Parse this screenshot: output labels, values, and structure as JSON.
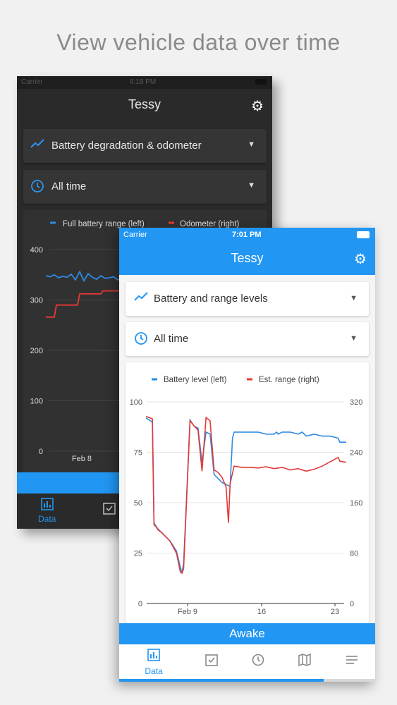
{
  "headline": "View vehicle data over time",
  "back_phone": {
    "status": {
      "carrier": "Carrier",
      "time": "6:18 PM"
    },
    "title": "Tessy",
    "metric_select": "Battery degradation & odometer",
    "range_select": "All time",
    "legend_left": "Full battery range (left)",
    "legend_right": "Odometer (right)",
    "tab_data": "Data"
  },
  "front_phone": {
    "status": {
      "carrier": "Carrier",
      "time": "7:01 PM"
    },
    "title": "Tessy",
    "metric_select": "Battery and range levels",
    "range_select": "All time",
    "awake_label": "Awake",
    "tabs": [
      {
        "name": "data",
        "label": "Data",
        "active": true
      },
      {
        "name": "tasks"
      },
      {
        "name": "history"
      },
      {
        "name": "map"
      },
      {
        "name": "menu"
      }
    ],
    "progress_fraction": 0.8
  },
  "colors": {
    "accent": "#2196f3",
    "series_left": "#2d8ae3",
    "series_right": "#e53935"
  },
  "chart_data": [
    {
      "type": "line",
      "x_ticks": [
        "Feb 8"
      ],
      "y_ticks": [
        0,
        100,
        200,
        300,
        400
      ],
      "ylim": [
        0,
        400
      ],
      "legend": "top",
      "series": [
        {
          "name": "Full battery range (left)",
          "x": [
            0,
            0.1,
            0.2,
            0.3,
            0.4,
            0.5,
            0.6,
            0.7,
            0.8,
            0.9,
            1.0,
            1.1,
            1.2,
            1.3,
            1.4,
            1.5,
            1.6,
            1.7,
            1.8,
            1.9,
            2.0,
            2.1,
            2.2,
            2.3,
            2.4,
            2.5,
            2.6,
            2.7,
            2.8,
            2.9,
            3.0
          ],
          "values": [
            348,
            346,
            350,
            344,
            347,
            345,
            351,
            340,
            356,
            338,
            352,
            345,
            341,
            348,
            343,
            344,
            346,
            340,
            342,
            345,
            341,
            343,
            340,
            342,
            341,
            340,
            342,
            341,
            340,
            341,
            340
          ]
        },
        {
          "name": "Odometer (right)",
          "x": [
            0,
            0.1,
            0.2,
            0.25,
            0.5,
            0.75,
            0.8,
            1.0,
            1.3,
            1.35,
            1.8,
            1.85,
            2.1,
            2.2,
            2.5,
            2.6,
            3.0
          ],
          "values": [
            266,
            266,
            266,
            290,
            290,
            290,
            312,
            312,
            312,
            318,
            318,
            330,
            330,
            336,
            336,
            340,
            340
          ]
        }
      ]
    },
    {
      "type": "line",
      "x_ticks": [
        "Feb 9",
        "16",
        "23"
      ],
      "y_left_ticks": [
        0,
        25,
        50,
        75,
        100
      ],
      "y_right_ticks": [
        0,
        80,
        160,
        240,
        320
      ],
      "ylim_left": [
        0,
        100
      ],
      "ylim_right": [
        0,
        320
      ],
      "legend": "top",
      "series": [
        {
          "name": "Battery level (left)",
          "axis": "left",
          "x": [
            0,
            0.8,
            1.0,
            1.3,
            1.5,
            2.0,
            3.0,
            3.8,
            4.3,
            4.5,
            4.7,
            5.5,
            6.0,
            6.5,
            7.0,
            7.5,
            8.0,
            8.5,
            9.0,
            9.5,
            10.5,
            10.8,
            11.0,
            11.3,
            11.5,
            12.0,
            13,
            14,
            15,
            16,
            16.3,
            16.5,
            17,
            18,
            19,
            19.5,
            20,
            21,
            22,
            23,
            24,
            24.2,
            25
          ],
          "values": [
            92,
            90,
            40,
            38,
            37,
            35,
            31,
            26,
            18,
            15,
            20,
            91,
            88,
            87,
            70,
            85,
            84,
            64,
            62,
            60,
            58,
            82,
            85,
            85,
            85,
            85,
            85,
            85,
            84,
            84,
            85,
            84,
            85,
            85,
            84,
            85,
            83,
            84,
            83,
            83,
            82,
            80,
            80
          ]
        },
        {
          "name": "Est. range (right)",
          "axis": "right",
          "x": [
            0,
            0.8,
            1.0,
            1.3,
            1.5,
            2.0,
            3.0,
            3.8,
            4.3,
            4.5,
            4.7,
            5.5,
            6.0,
            6.5,
            7.0,
            7.5,
            8.0,
            8.5,
            9.0,
            9.5,
            10.0,
            10.3,
            10.5,
            11.0,
            12,
            13,
            14,
            15,
            16,
            17,
            18,
            19,
            20,
            21,
            22,
            23,
            24,
            24.2,
            25
          ],
          "values": [
            297,
            293,
            125,
            121,
            117,
            112,
            99,
            80,
            50,
            48,
            55,
            290,
            282,
            275,
            210,
            295,
            290,
            212,
            208,
            200,
            185,
            128,
            190,
            218,
            216,
            216,
            215,
            217,
            214,
            216,
            212,
            214,
            210,
            213,
            218,
            225,
            232,
            226,
            224
          ]
        }
      ]
    }
  ]
}
